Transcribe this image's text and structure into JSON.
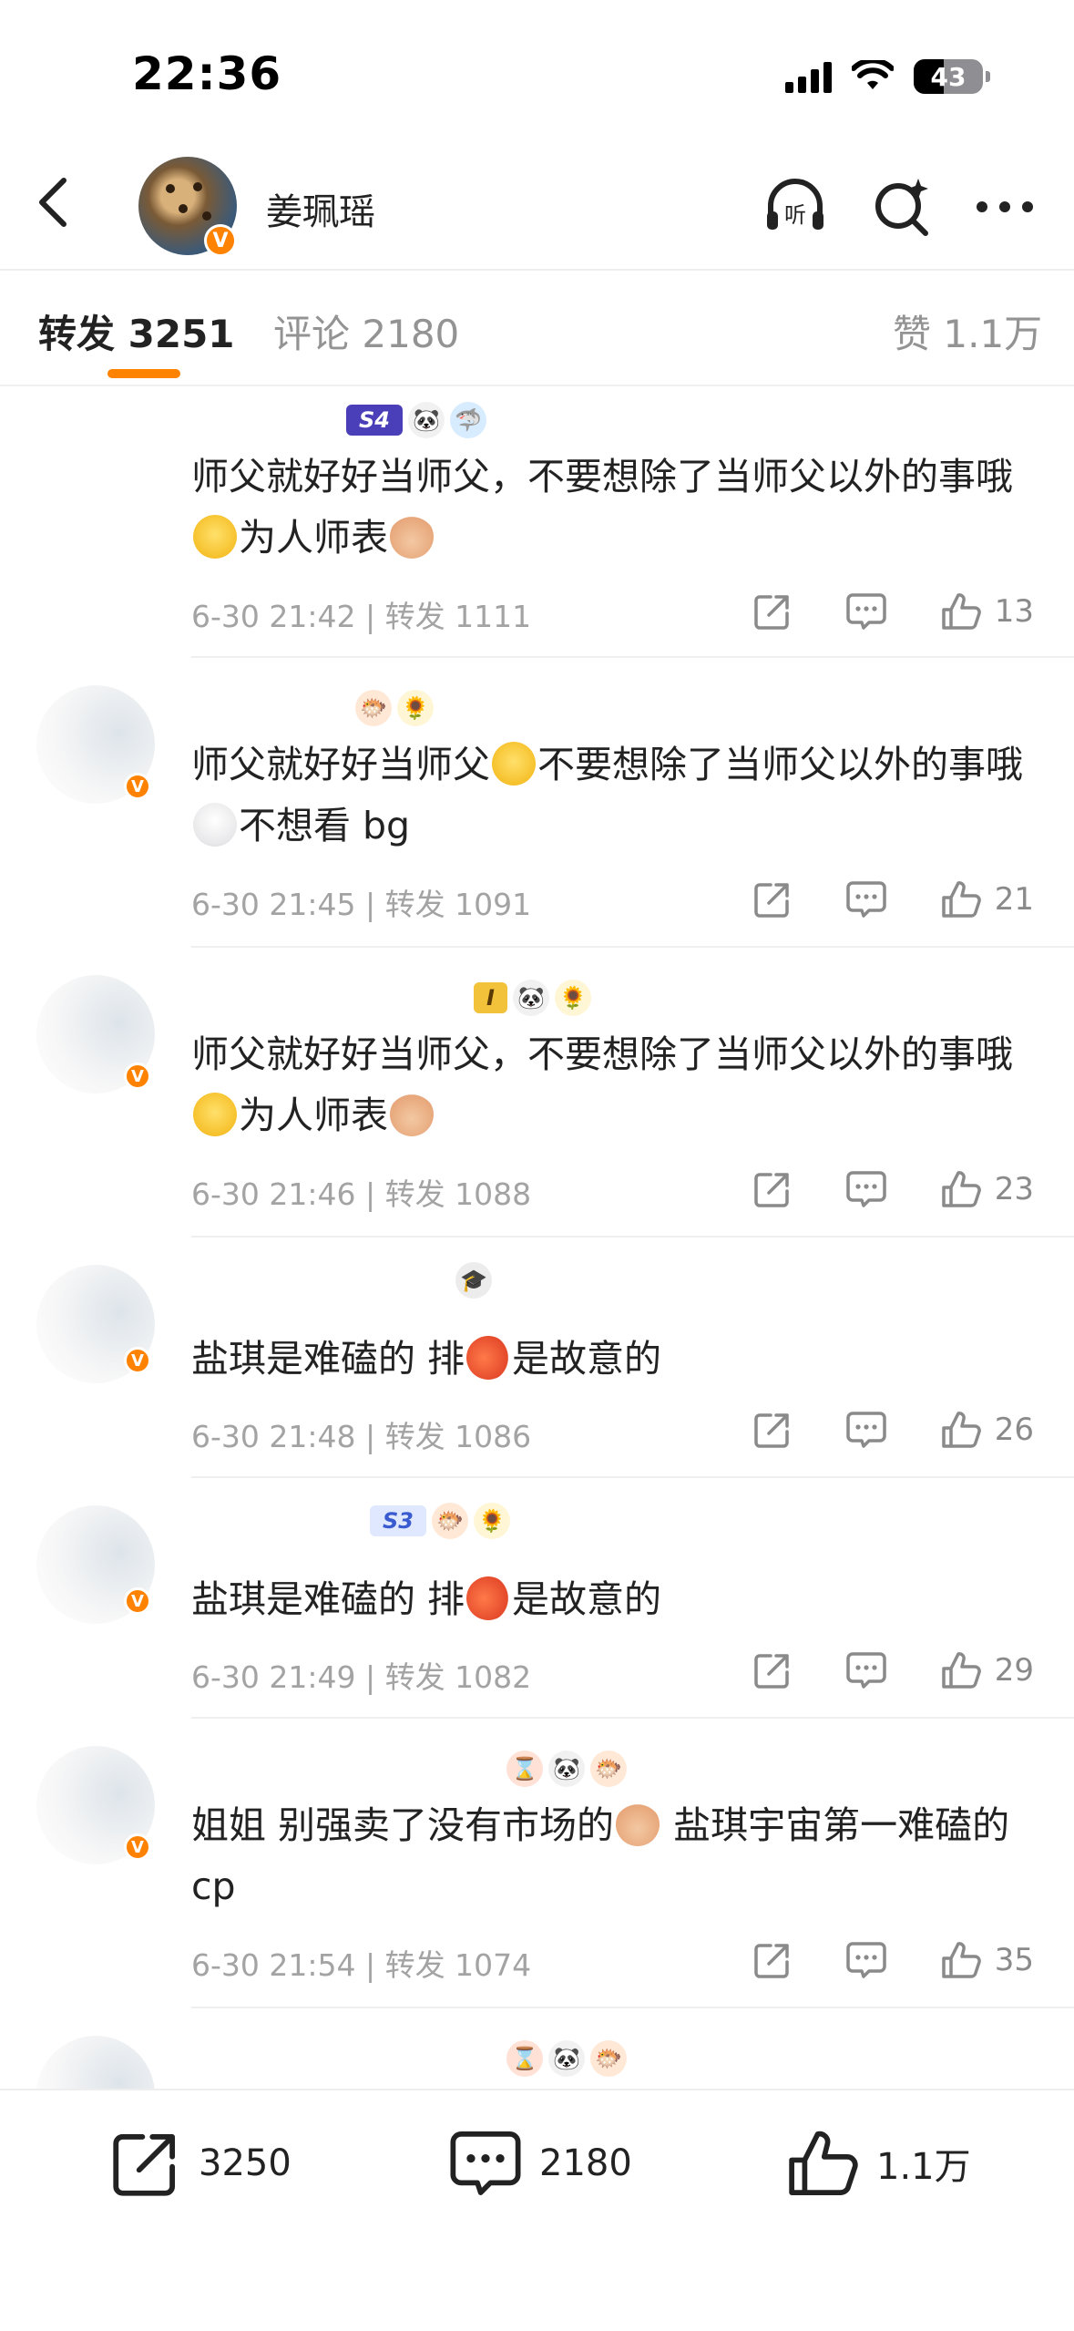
{
  "status_bar": {
    "time": "22:36",
    "battery": "43"
  },
  "header": {
    "username": "姜珮瑶"
  },
  "tabs": {
    "repost_label": "转发",
    "repost_count": "3251",
    "comment_label": "评论",
    "comment_count": "2180",
    "like_label": "赞",
    "like_count": "1.1万"
  },
  "items": [
    {
      "text_a": "师父就好好当师父，不要想除了当师父以外的事哦",
      "text_b": "为人师表",
      "time": "6-30 21:42",
      "repost": "| 转发 1111",
      "likes": "13",
      "chip": "S4"
    },
    {
      "text_a": "师父就好好当师父",
      "text_b": "不要想除了当师父以外的事哦",
      "text_c": "不想看 bg",
      "time": "6-30 21:45",
      "repost": "| 转发 1091",
      "likes": "21"
    },
    {
      "text_a": "师父就好好当师父，不要想除了当师父以外的事哦",
      "text_b": "为人师表",
      "time": "6-30 21:46",
      "repost": "| 转发 1088",
      "likes": "23",
      "chip": "I"
    },
    {
      "text_a": "盐琪是难磕的 排",
      "text_b": "是故意的",
      "time": "6-30 21:48",
      "repost": "| 转发 1086",
      "likes": "26"
    },
    {
      "text_a": "盐琪是难磕的 排",
      "text_b": "是故意的",
      "time": "6-30 21:49",
      "repost": "| 转发 1082",
      "likes": "29",
      "chip": "S3"
    },
    {
      "text_a": "姐姐 别强卖了没有市场的",
      "text_b": "盐琪宇宙第一难磕的 cp",
      "time": "6-30 21:54",
      "repost": "| 转发 1074",
      "likes": "35"
    }
  ],
  "bottom_bar": {
    "repost": "3250",
    "comment": "2180",
    "like": "1.1万"
  },
  "colors": {
    "accent": "#ff8200",
    "meta_gray": "#a3a3a3"
  }
}
